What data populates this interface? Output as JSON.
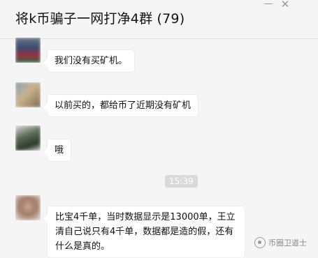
{
  "header": {
    "title": "将k币骗子一网打净4群 (79)",
    "minimize_glyph": "—",
    "close_glyph": "✕"
  },
  "messages": [
    {
      "text": "我们没有买矿机。"
    },
    {
      "text": "以前买的，都给币了近期没有矿机"
    },
    {
      "text": "哦"
    },
    {
      "text": "比宝4千单，当时数据显示是13000单，王立清自己说只有4千单，数据都是造的假，还有什么是真的。"
    }
  ],
  "time_divider": "15:39",
  "watermark": {
    "text": "币圈卫道士",
    "icon": "watermark-logo-icon"
  },
  "colors": {
    "background": "#f5f5f5",
    "bubble": "#ffffff",
    "time_chip": "#dadada"
  }
}
